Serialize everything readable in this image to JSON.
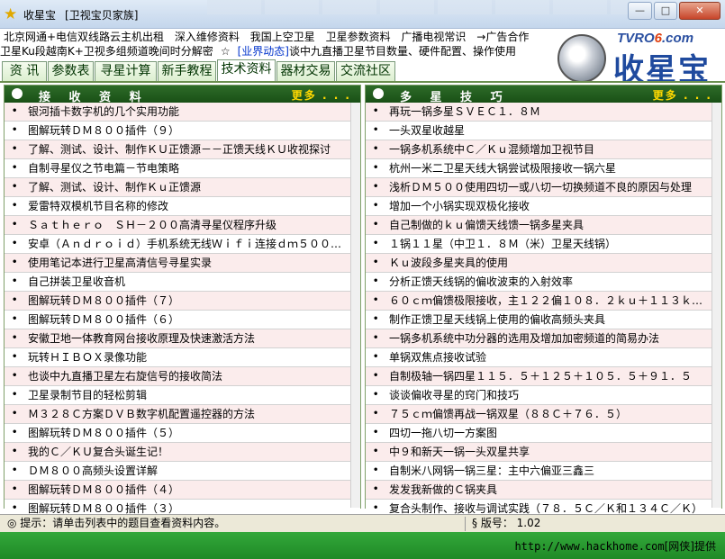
{
  "window": {
    "title": "收星宝",
    "subtitle": "[卫视宝贝家族]",
    "minimize_label": "—",
    "maximize_label": "□",
    "close_label": "✕"
  },
  "top_links": {
    "row1": [
      "北京网通+电信双线路云主机出租",
      "深入维修资料",
      "我国上空卫星",
      "卫星参数资料",
      "广播电视常识",
      "→广告合作"
    ],
    "row2_black": "卫星Ku段越南K+卫视多组频道晚间时分解密",
    "row2_star": "☆",
    "row2_blue": "[业界动态]",
    "row2_tail": "谈中九直播卫星节目数量、硬件配置、操作使用"
  },
  "logo": {
    "tvro_prefix": "TVRO",
    "tvro_six": "6",
    "tvro_suffix": ".com",
    "brand": "收星宝"
  },
  "tabs": [
    "资 讯",
    "参数表",
    "寻星计算",
    "新手教程",
    "技术资料",
    "器材交易",
    "交流社区"
  ],
  "active_tab": 4,
  "left_panel": {
    "title": "接 收 资 料",
    "more": "更多 . . .",
    "items": [
      "银河插卡数字机的几个实用功能",
      "图解玩转ＤＭ８００插件（９）",
      "了解、测试、设计、制作ＫＵ正馈源－－正馈天线ＫＵ收视探讨",
      "自制寻星仪之节电篇－节电策略",
      "了解、测试、设计、制作Ｋｕ正馈源",
      "爱雷特双模机节目名称的修改",
      "Ｓａｔｈｅｒｏ　ＳＨ－２００高清寻星仪程序升级",
      "安卓（Ａｎｄｒｏｉｄ）手机系统无线Ｗｉｆｉ连接ｄｍ５００…",
      "使用笔记本进行卫星高清信号寻星实录",
      "自己拼装卫星收音机",
      "图解玩转ＤＭ８００插件（７）",
      "图解玩转ＤＭ８００插件（６）",
      "安徽卫地一体教育网台接收原理及快速激活方法",
      "玩转ＨＩＢＯＸ录像功能",
      "也谈中九直播卫星左右旋信号的接收简法",
      "卫星录制节目的轻松剪辑",
      "Ｍ３２８Ｃ方案ＤＶＢ数字机配置遥控器的方法",
      "图解玩转ＤＭ８００插件（５）",
      "我的Ｃ／ＫＵ复合头诞生记！",
      "ＤＭ８００高频头设置详解",
      "图解玩转ＤＭ８００插件（４）",
      "图解玩转ＤＭ８００插件（３）"
    ]
  },
  "right_panel": {
    "title": "多 星 技 巧",
    "more": "更多 . . .",
    "items": [
      "再玩一锅多星ＳＶＥＣ１．８Ｍ",
      "一头双星收越星",
      "一锅多机系统中Ｃ／Ｋｕ混频增加卫视节目",
      "杭州一米二卫星天线大锅尝试极限接收一锅六星",
      "浅析ＤＭ５００使用四切一或八切一切换频道不良的原因与处理",
      "增加一个小锅实现双极化接收",
      "自己制做的ｋｕ偏馈天线馈一锅多星夹具",
      "１锅１１星（中卫１．８Ｍ（米）卫星天线锅）",
      "Ｋｕ波段多星夹具的使用",
      "分析正馈天线锅的偏收波束的入射效率",
      "６０ｃｍ偏馈极限接收，主１２２偏１０８．２ｋｕ＋１１３ｋ…",
      "制作正馈卫星天线锅上使用的偏收高频头夹具",
      "一锅多机系统中功分器的选用及增加加密频道的简易办法",
      "单锅双焦点接收试验",
      "自制极轴一锅四星１１５．５＋１２５＋１０５．５＋９１．５",
      "谈谈偏收寻星的窍门和技巧",
      "７５ｃｍ偏馈再战一锅双星（８８Ｃ＋７６．５）",
      "四切一拖八切一方案图",
      "中９和新天一锅一头双星共享",
      "自制米八网锅一锅三星：主中六偏亚三鑫三",
      "发发我新做的Ｃ锅夹具",
      "复合头制作、接收与调试实践（７８．５Ｃ／Ｋ和１３４Ｃ／Ｋ）"
    ]
  },
  "status": {
    "hint": "◎ 提示：请单击列表中的题目查看资料内容。",
    "version": "§ 版号： 1.02"
  },
  "footer": {
    "url": "http://www.hackhome.com",
    "suffix": "[网侠]提供"
  }
}
